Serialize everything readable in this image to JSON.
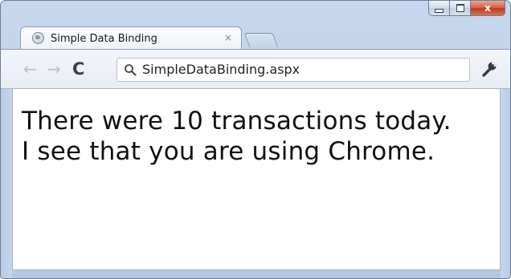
{
  "browser": {
    "tab": {
      "title": "Simple Data Binding",
      "close_glyph": "×",
      "favicon_icon": "globe-icon"
    },
    "window_controls": {
      "minimize_icon": "minimize-icon",
      "maximize_icon": "maximize-icon",
      "close_glyph": "x"
    },
    "toolbar": {
      "back_glyph": "←",
      "forward_glyph": "→",
      "reload_glyph": "C",
      "address": "SimpleDataBinding.aspx",
      "search_icon": "search-icon",
      "menu_icon": "wrench-icon"
    }
  },
  "page": {
    "lines": [
      "There were 10 transactions today.",
      "I see that you are using Chrome."
    ]
  },
  "colors": {
    "frame": "#b9cce6",
    "close_button": "#c2391c",
    "content_background": "#ffffff",
    "text": "#111111"
  }
}
